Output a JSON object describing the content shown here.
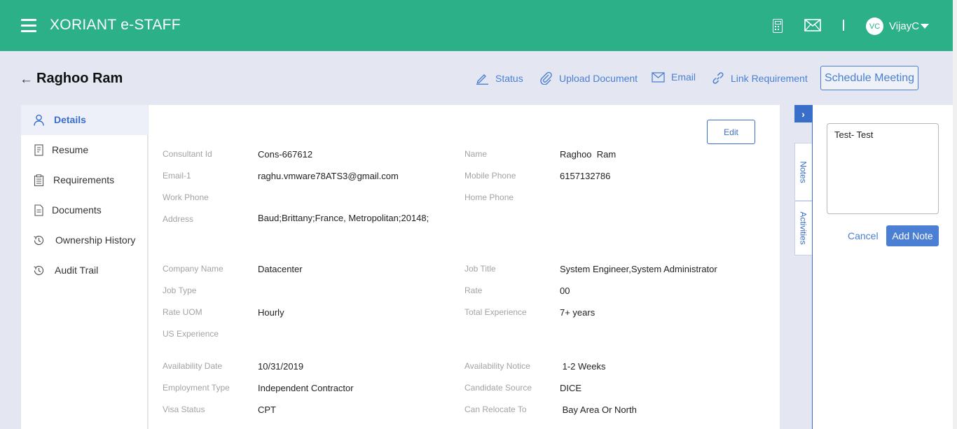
{
  "app": {
    "title": "XORIANT e-STAFF"
  },
  "user": {
    "initials": "VC",
    "name": "VijayC"
  },
  "page": {
    "back_symbol": "←",
    "title": "Raghoo Ram"
  },
  "actions": {
    "status": "Status",
    "upload": "Upload Document",
    "email": "Email",
    "link": "Link Requirement",
    "schedule": "Schedule Meeting"
  },
  "nav": [
    {
      "label": "Details",
      "icon": "person-icon",
      "active": true
    },
    {
      "label": "Resume",
      "icon": "document-icon"
    },
    {
      "label": "Requirements",
      "icon": "clipboard-icon"
    },
    {
      "label": "Documents",
      "icon": "file-icon"
    },
    {
      "label": "Ownership History",
      "icon": "history-icon"
    },
    {
      "label": "Audit Trail",
      "icon": "history-icon"
    }
  ],
  "details": {
    "edit_label": "Edit",
    "fields": [
      {
        "label": "Consultant Id",
        "value": "Cons-667612"
      },
      {
        "label": "Name",
        "value": "Raghoo  Ram"
      },
      {
        "label": "Email-1",
        "value": "raghu.vmware78ATS3@gmail.com"
      },
      {
        "label": "Mobile Phone",
        "value": "6157132786"
      },
      {
        "label": "Work Phone",
        "value": ""
      },
      {
        "label": "Home Phone",
        "value": ""
      },
      {
        "label": "Address",
        "value": "Baud;Brittany;France, Metropolitan;20148;"
      },
      {
        "label": "Company Name",
        "value": "Datacenter"
      },
      {
        "label": "Job Title",
        "value": "System Engineer,System Administrator"
      },
      {
        "label": "Job Type",
        "value": ""
      },
      {
        "label": "Rate",
        "value": "00"
      },
      {
        "label": "Rate UOM",
        "value": "Hourly"
      },
      {
        "label": "Total Experience",
        "value": "7+ years"
      },
      {
        "label": "US Experience",
        "value": ""
      },
      {
        "label": "Availability Date",
        "value": "10/31/2019"
      },
      {
        "label": "Availability Notice",
        "value": " 1-2 Weeks"
      },
      {
        "label": "Employment Type",
        "value": "Independent Contractor"
      },
      {
        "label": "Candidate Source",
        "value": "DICE"
      },
      {
        "label": "Visa Status",
        "value": "CPT"
      },
      {
        "label": "Can Relocate To",
        "value": " Bay Area Or North"
      }
    ]
  },
  "side_tabs": {
    "toggle": "›",
    "notes": "Notes",
    "activities": "Activities"
  },
  "notes_panel": {
    "note_text": "Test- Test",
    "cancel_label": "Cancel",
    "add_label": "Add Note"
  },
  "colors": {
    "header": "#2bb087",
    "accent": "#3a6fc9",
    "link": "#4a7fd4"
  }
}
